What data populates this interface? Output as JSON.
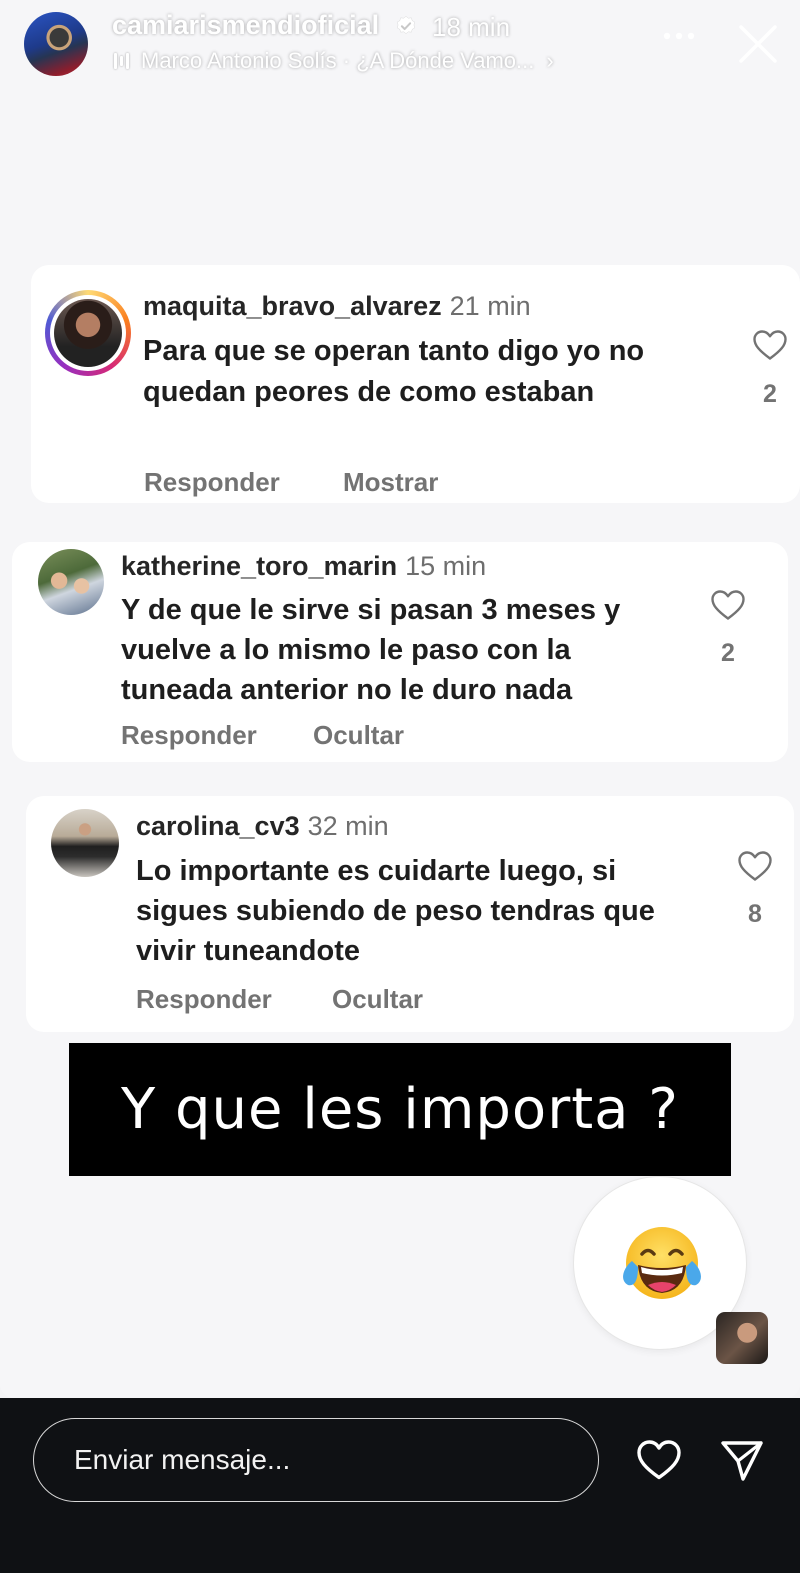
{
  "header": {
    "username": "camiarismendioficial",
    "time_ago": "18 min",
    "music": "Marco Antonio Solís · ¿A Dónde Vamo...",
    "music_chevron": "›",
    "icons": [
      "verified-badge-icon",
      "music-bars-icon",
      "more-icon",
      "close-icon"
    ]
  },
  "comments": [
    {
      "username": "maquita_bravo_alvarez",
      "time": "21 min",
      "text": "Para que se operan tanto digo yo no quedan peores de como estaban",
      "reply_label": "Responder",
      "toggle_label": "Mostrar",
      "likes": "2"
    },
    {
      "username": "katherine_toro_marin",
      "time": "15 min",
      "text": "Y de que le sirve si pasan 3 meses y vuelve a lo mismo le paso con la tuneada anterior no le duro nada",
      "reply_label": "Responder",
      "toggle_label": "Ocultar",
      "likes": "2"
    },
    {
      "username": "carolina_cv3",
      "time": "32 min",
      "text": "Lo importante es cuidarte luego, si sigues subiendo de peso tendras que vivir tuneandote",
      "reply_label": "Responder",
      "toggle_label": "Ocultar",
      "likes": "8"
    }
  ],
  "banner_text": "Y que les importa ?",
  "reaction_emoji": "face-with-tears-of-joy",
  "composer": {
    "placeholder": "Enviar mensaje..."
  },
  "colors": {
    "story_bg": "#f6f6f8",
    "card_bg": "#ffffff",
    "bottom_bar": "#0f1114",
    "muted_text": "#737373",
    "story_ring": [
      "#feda75",
      "#fa7e1e",
      "#d62976",
      "#962fbf"
    ]
  }
}
